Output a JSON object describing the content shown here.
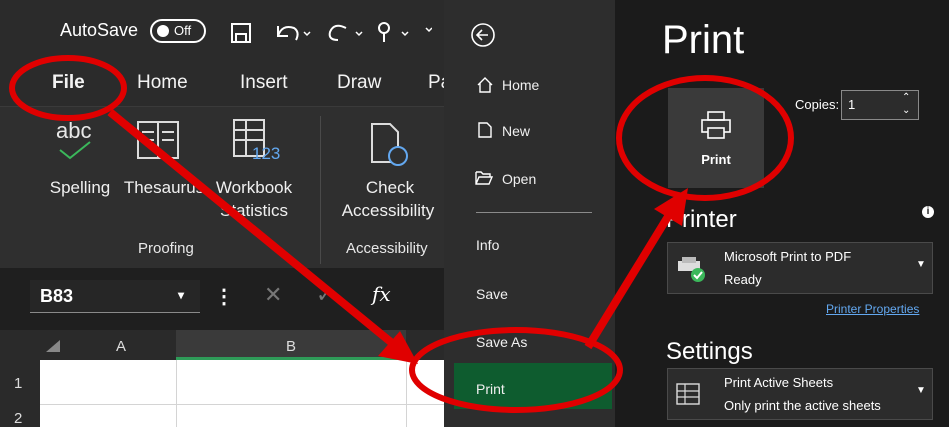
{
  "qat": {
    "autosave": "AutoSave",
    "toggle": "Off"
  },
  "tabs": [
    "File",
    "Home",
    "Insert",
    "Draw",
    "Pa"
  ],
  "ribbon": {
    "abc": "abc",
    "num123": "123",
    "spelling": "Spelling",
    "thesaurus": "Thesaurus",
    "workbook_l1": "Workbook",
    "workbook_l2": "Statistics",
    "check_l1": "Check",
    "check_l2": "Accessibility",
    "proofing": "Proofing",
    "accessibility": "Accessibility"
  },
  "formula_bar": {
    "namebox": "B83",
    "fx": "fx"
  },
  "grid": {
    "cols": [
      "A",
      "B"
    ],
    "rows": [
      "1",
      "2"
    ]
  },
  "backstage": {
    "nav": [
      "Home",
      "New",
      "Open",
      "Info",
      "Save",
      "Save As",
      "Print"
    ],
    "title": "Print",
    "print_button": "Print",
    "copies_label": "Copies:",
    "copies_value": "1",
    "printer_heading": "Printer",
    "printer_name": "Microsoft Print to PDF",
    "printer_status": "Ready",
    "printer_properties": "Printer Properties",
    "settings_heading": "Settings",
    "setting1_title": "Print Active Sheets",
    "setting1_desc": "Only print the active sheets"
  },
  "colors": {
    "excel_green": "#0e5c2f",
    "annotation_red": "#e00000",
    "link_blue": "#63a8f0"
  }
}
